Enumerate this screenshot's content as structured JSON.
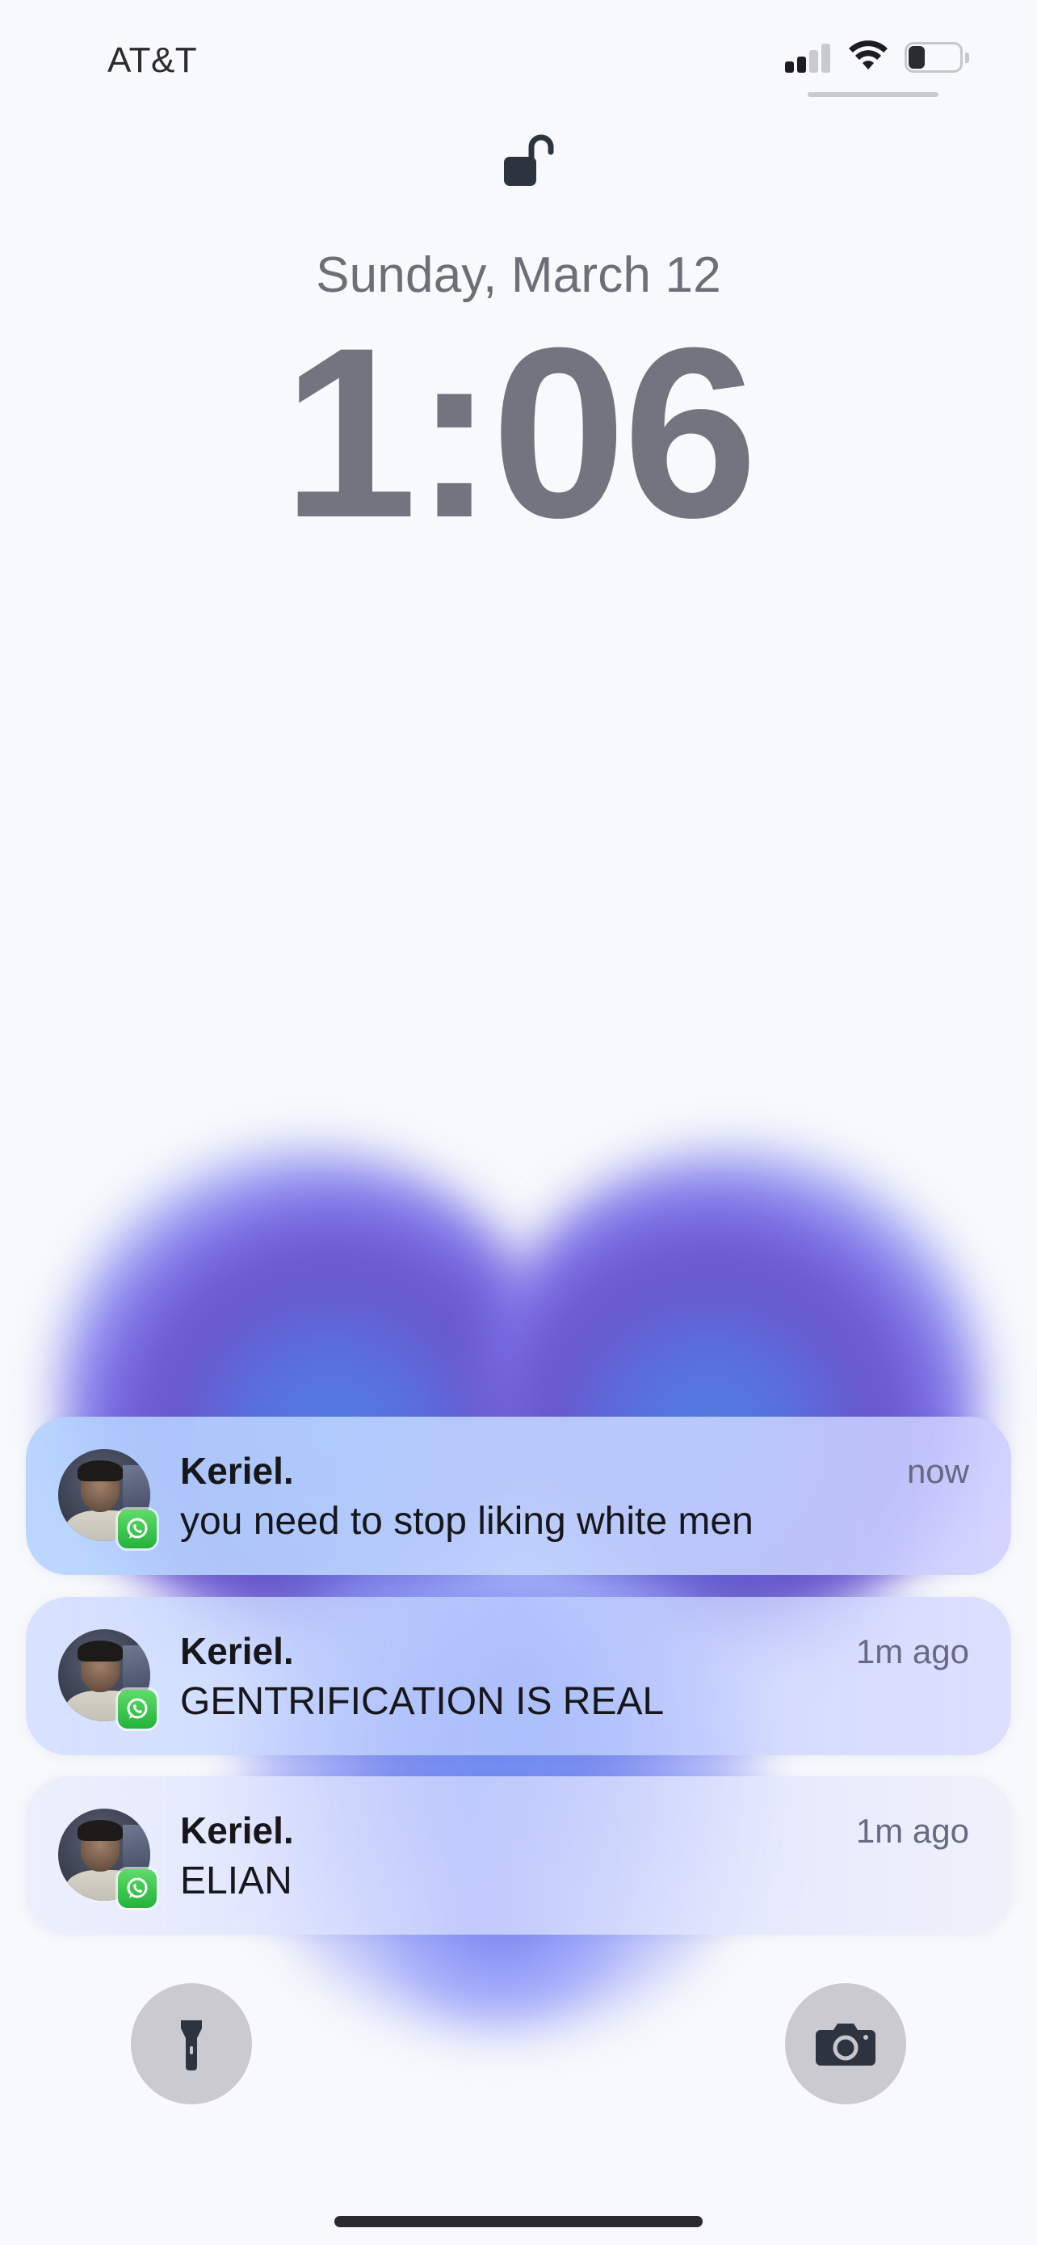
{
  "status_bar": {
    "carrier": "AT&T",
    "signal_bars_active": 2,
    "signal_bars_total": 4,
    "wifi_icon": "wifi-icon",
    "battery_level": 0.35
  },
  "lock": {
    "icon": "unlocked-padlock-icon",
    "date": "Sunday, March 12",
    "time": "1:06"
  },
  "notifications": [
    {
      "sender": "Keriel.",
      "time": "now",
      "message": "you need to stop liking white men",
      "app_icon": "whatsapp-icon"
    },
    {
      "sender": "Keriel.",
      "time": "1m ago",
      "message": "GENTRIFICATION IS REAL",
      "app_icon": "whatsapp-icon"
    },
    {
      "sender": "Keriel.",
      "time": "1m ago",
      "message": "ELIAN",
      "app_icon": "whatsapp-icon"
    }
  ],
  "quick_actions": {
    "left_icon": "flashlight-icon",
    "right_icon": "camera-icon"
  },
  "colors": {
    "background": "#f8f9fc",
    "clock": "#72757f",
    "date": "#6d6f78",
    "wallpaper_heart": "#6a55c8",
    "whatsapp_green": "#23b33a"
  }
}
